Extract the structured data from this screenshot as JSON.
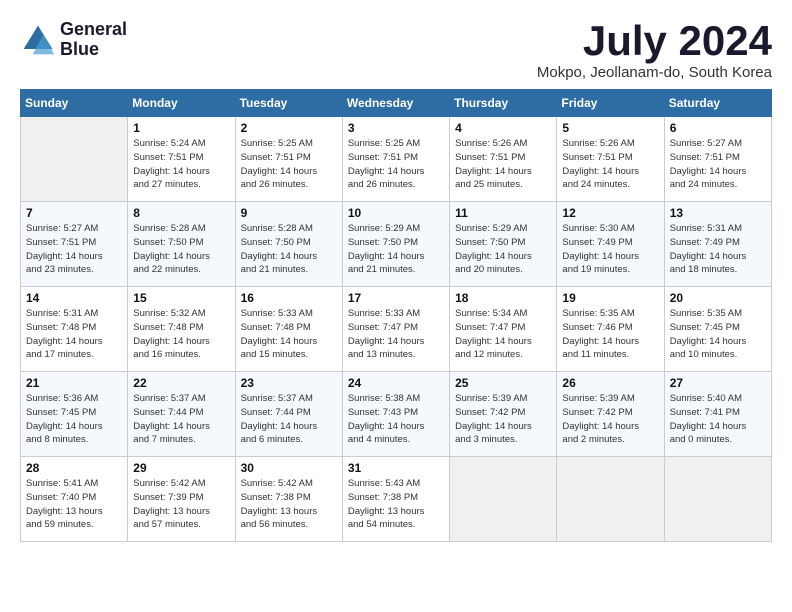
{
  "header": {
    "logo_line1": "General",
    "logo_line2": "Blue",
    "month_title": "July 2024",
    "location": "Mokpo, Jeollanam-do, South Korea"
  },
  "weekdays": [
    "Sunday",
    "Monday",
    "Tuesday",
    "Wednesday",
    "Thursday",
    "Friday",
    "Saturday"
  ],
  "weeks": [
    [
      {
        "day": "",
        "info": ""
      },
      {
        "day": "1",
        "info": "Sunrise: 5:24 AM\nSunset: 7:51 PM\nDaylight: 14 hours\nand 27 minutes."
      },
      {
        "day": "2",
        "info": "Sunrise: 5:25 AM\nSunset: 7:51 PM\nDaylight: 14 hours\nand 26 minutes."
      },
      {
        "day": "3",
        "info": "Sunrise: 5:25 AM\nSunset: 7:51 PM\nDaylight: 14 hours\nand 26 minutes."
      },
      {
        "day": "4",
        "info": "Sunrise: 5:26 AM\nSunset: 7:51 PM\nDaylight: 14 hours\nand 25 minutes."
      },
      {
        "day": "5",
        "info": "Sunrise: 5:26 AM\nSunset: 7:51 PM\nDaylight: 14 hours\nand 24 minutes."
      },
      {
        "day": "6",
        "info": "Sunrise: 5:27 AM\nSunset: 7:51 PM\nDaylight: 14 hours\nand 24 minutes."
      }
    ],
    [
      {
        "day": "7",
        "info": "Sunrise: 5:27 AM\nSunset: 7:51 PM\nDaylight: 14 hours\nand 23 minutes."
      },
      {
        "day": "8",
        "info": "Sunrise: 5:28 AM\nSunset: 7:50 PM\nDaylight: 14 hours\nand 22 minutes."
      },
      {
        "day": "9",
        "info": "Sunrise: 5:28 AM\nSunset: 7:50 PM\nDaylight: 14 hours\nand 21 minutes."
      },
      {
        "day": "10",
        "info": "Sunrise: 5:29 AM\nSunset: 7:50 PM\nDaylight: 14 hours\nand 21 minutes."
      },
      {
        "day": "11",
        "info": "Sunrise: 5:29 AM\nSunset: 7:50 PM\nDaylight: 14 hours\nand 20 minutes."
      },
      {
        "day": "12",
        "info": "Sunrise: 5:30 AM\nSunset: 7:49 PM\nDaylight: 14 hours\nand 19 minutes."
      },
      {
        "day": "13",
        "info": "Sunrise: 5:31 AM\nSunset: 7:49 PM\nDaylight: 14 hours\nand 18 minutes."
      }
    ],
    [
      {
        "day": "14",
        "info": "Sunrise: 5:31 AM\nSunset: 7:48 PM\nDaylight: 14 hours\nand 17 minutes."
      },
      {
        "day": "15",
        "info": "Sunrise: 5:32 AM\nSunset: 7:48 PM\nDaylight: 14 hours\nand 16 minutes."
      },
      {
        "day": "16",
        "info": "Sunrise: 5:33 AM\nSunset: 7:48 PM\nDaylight: 14 hours\nand 15 minutes."
      },
      {
        "day": "17",
        "info": "Sunrise: 5:33 AM\nSunset: 7:47 PM\nDaylight: 14 hours\nand 13 minutes."
      },
      {
        "day": "18",
        "info": "Sunrise: 5:34 AM\nSunset: 7:47 PM\nDaylight: 14 hours\nand 12 minutes."
      },
      {
        "day": "19",
        "info": "Sunrise: 5:35 AM\nSunset: 7:46 PM\nDaylight: 14 hours\nand 11 minutes."
      },
      {
        "day": "20",
        "info": "Sunrise: 5:35 AM\nSunset: 7:45 PM\nDaylight: 14 hours\nand 10 minutes."
      }
    ],
    [
      {
        "day": "21",
        "info": "Sunrise: 5:36 AM\nSunset: 7:45 PM\nDaylight: 14 hours\nand 8 minutes."
      },
      {
        "day": "22",
        "info": "Sunrise: 5:37 AM\nSunset: 7:44 PM\nDaylight: 14 hours\nand 7 minutes."
      },
      {
        "day": "23",
        "info": "Sunrise: 5:37 AM\nSunset: 7:44 PM\nDaylight: 14 hours\nand 6 minutes."
      },
      {
        "day": "24",
        "info": "Sunrise: 5:38 AM\nSunset: 7:43 PM\nDaylight: 14 hours\nand 4 minutes."
      },
      {
        "day": "25",
        "info": "Sunrise: 5:39 AM\nSunset: 7:42 PM\nDaylight: 14 hours\nand 3 minutes."
      },
      {
        "day": "26",
        "info": "Sunrise: 5:39 AM\nSunset: 7:42 PM\nDaylight: 14 hours\nand 2 minutes."
      },
      {
        "day": "27",
        "info": "Sunrise: 5:40 AM\nSunset: 7:41 PM\nDaylight: 14 hours\nand 0 minutes."
      }
    ],
    [
      {
        "day": "28",
        "info": "Sunrise: 5:41 AM\nSunset: 7:40 PM\nDaylight: 13 hours\nand 59 minutes."
      },
      {
        "day": "29",
        "info": "Sunrise: 5:42 AM\nSunset: 7:39 PM\nDaylight: 13 hours\nand 57 minutes."
      },
      {
        "day": "30",
        "info": "Sunrise: 5:42 AM\nSunset: 7:38 PM\nDaylight: 13 hours\nand 56 minutes."
      },
      {
        "day": "31",
        "info": "Sunrise: 5:43 AM\nSunset: 7:38 PM\nDaylight: 13 hours\nand 54 minutes."
      },
      {
        "day": "",
        "info": ""
      },
      {
        "day": "",
        "info": ""
      },
      {
        "day": "",
        "info": ""
      }
    ]
  ]
}
